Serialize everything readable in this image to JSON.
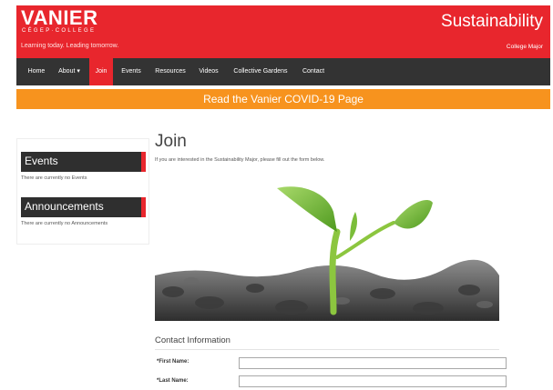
{
  "header": {
    "logo": "VANIER",
    "logo_sub": "CÉGEP·COLLEGE",
    "tagline": "Learning today. Leading tomorrow.",
    "site_title": "Sustainability",
    "subsite_label": "College Major",
    "bg_color": "#e8262d"
  },
  "nav": {
    "items": [
      {
        "label": "Home"
      },
      {
        "label": "About ▾"
      },
      {
        "label": "Join",
        "active": true
      },
      {
        "label": "Events"
      },
      {
        "label": "Resources"
      },
      {
        "label": "Videos"
      },
      {
        "label": "Collective Gardens"
      },
      {
        "label": "Contact"
      }
    ]
  },
  "banner": {
    "text": "Read the Vanier COVID-19 Page",
    "color": "#f7931e"
  },
  "sidebar": {
    "events_title": "Events",
    "events_note": "There are currently no Events",
    "announcements_title": "Announcements",
    "announcements_note": "There are currently no Announcements"
  },
  "main": {
    "title": "Join",
    "intro": "If you are interested in the Sustainability Major, please fill out the form below.",
    "hero_icon": "seedling-image"
  },
  "form": {
    "section_title": "Contact Information",
    "first_name_label": "*First Name:",
    "first_name_value": "",
    "last_name_label": "*Last Name:",
    "last_name_value": ""
  }
}
